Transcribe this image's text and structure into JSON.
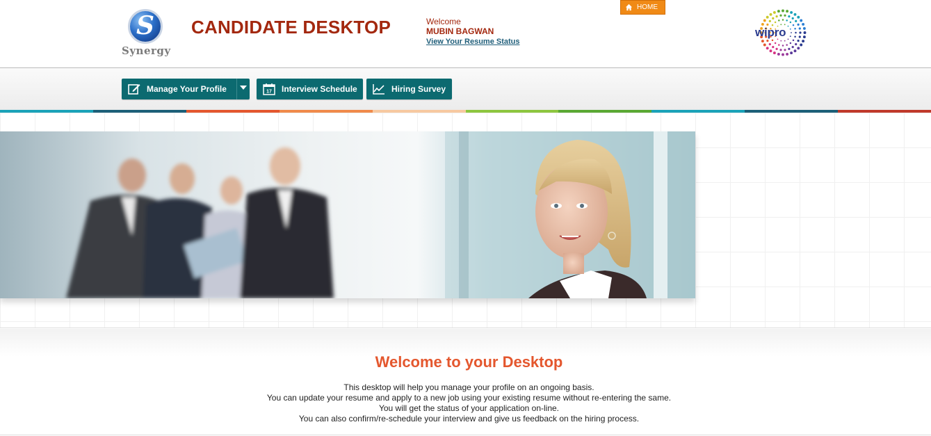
{
  "header": {
    "synergy_logo_text": "Synergy",
    "synergy_logo_letter": "S",
    "app_title": "CANDIDATE DESKTOP",
    "welcome_label": "Welcome",
    "user_name": "MUBIN BAGWAN",
    "resume_status_link": "View Your Resume Status",
    "home_button": "HOME",
    "wipro_logo_text": "wipro"
  },
  "nav": {
    "items": [
      {
        "label": "Manage Your Profile",
        "icon": "edit-icon",
        "has_dropdown": true
      },
      {
        "label": "Interview Schedule",
        "icon": "calendar-icon",
        "calendar_day": "17"
      },
      {
        "label": "Hiring Survey",
        "icon": "chart-line-icon"
      }
    ],
    "accent_color": "#0c6a70"
  },
  "stripe_colors": [
    "#1aa2b8",
    "#1c5f78",
    "#e4572e",
    "#f08a4b",
    "#f7c9a0",
    "#8dc63f",
    "#5aa833",
    "#1aa2b8",
    "#1c5f78",
    "#c0392b"
  ],
  "welcome": {
    "title": "Welcome to your Desktop",
    "lines": [
      "This desktop will help you manage your profile on an ongoing basis.",
      "You can update your resume and apply to a new job using your existing resume without re-entering the same.",
      "You will get the status of your application on-line.",
      "You can also confirm/re-schedule your interview and give us feedback on the hiring process."
    ]
  }
}
